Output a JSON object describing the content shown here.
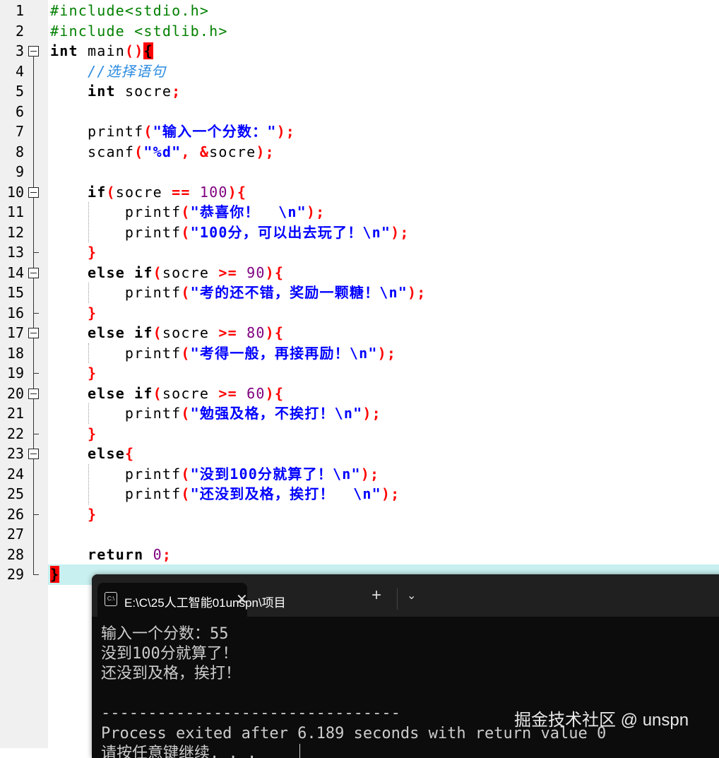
{
  "editor": {
    "current_line": 29,
    "fold_starts": [
      3,
      10,
      14,
      17,
      20,
      23
    ],
    "fold_ends": [
      13,
      16,
      19,
      22,
      26,
      29
    ],
    "lines": [
      [
        [
          "pp",
          "#include<stdio.h>"
        ]
      ],
      [
        [
          "pp",
          "#include <stdlib.h>"
        ]
      ],
      [
        [
          "kw",
          "int"
        ],
        [
          "id",
          " main"
        ],
        [
          "op",
          "()"
        ],
        [
          "hl",
          "{"
        ]
      ],
      [
        [
          "id",
          "    "
        ],
        [
          "cm",
          "//选择语句"
        ]
      ],
      [
        [
          "id",
          "    "
        ],
        [
          "kw",
          "int"
        ],
        [
          "id",
          " socre"
        ],
        [
          "op",
          ";"
        ]
      ],
      [],
      [
        [
          "id",
          "    printf"
        ],
        [
          "op",
          "("
        ],
        [
          "str",
          "\"输入一个分数：\""
        ],
        [
          "op",
          ");"
        ]
      ],
      [
        [
          "id",
          "    scanf"
        ],
        [
          "op",
          "("
        ],
        [
          "str",
          "\"%d\""
        ],
        [
          "op",
          ", &"
        ],
        [
          "id",
          "socre"
        ],
        [
          "op",
          ");"
        ]
      ],
      [],
      [
        [
          "id",
          "    "
        ],
        [
          "kw",
          "if"
        ],
        [
          "op",
          "("
        ],
        [
          "id",
          "socre "
        ],
        [
          "op",
          "=="
        ],
        [
          "id",
          " "
        ],
        [
          "num",
          "100"
        ],
        [
          "op",
          "){"
        ]
      ],
      [
        [
          "id",
          "        printf"
        ],
        [
          "op",
          "("
        ],
        [
          "str",
          "\"恭喜你！  \\n\""
        ],
        [
          "op",
          ");"
        ]
      ],
      [
        [
          "id",
          "        printf"
        ],
        [
          "op",
          "("
        ],
        [
          "str",
          "\"100分，可以出去玩了！\\n\""
        ],
        [
          "op",
          ");"
        ]
      ],
      [
        [
          "id",
          "    "
        ],
        [
          "op",
          "}"
        ]
      ],
      [
        [
          "id",
          "    "
        ],
        [
          "kw",
          "else if"
        ],
        [
          "op",
          "("
        ],
        [
          "id",
          "socre "
        ],
        [
          "op",
          ">="
        ],
        [
          "id",
          " "
        ],
        [
          "num",
          "90"
        ],
        [
          "op",
          "){"
        ]
      ],
      [
        [
          "id",
          "        printf"
        ],
        [
          "op",
          "("
        ],
        [
          "str",
          "\"考的还不错，奖励一颗糖！\\n\""
        ],
        [
          "op",
          ");"
        ]
      ],
      [
        [
          "id",
          "    "
        ],
        [
          "op",
          "}"
        ]
      ],
      [
        [
          "id",
          "    "
        ],
        [
          "kw",
          "else if"
        ],
        [
          "op",
          "("
        ],
        [
          "id",
          "socre "
        ],
        [
          "op",
          ">="
        ],
        [
          "id",
          " "
        ],
        [
          "num",
          "80"
        ],
        [
          "op",
          "){"
        ]
      ],
      [
        [
          "id",
          "        printf"
        ],
        [
          "op",
          "("
        ],
        [
          "str",
          "\"考得一般，再接再励！\\n\""
        ],
        [
          "op",
          ");"
        ]
      ],
      [
        [
          "id",
          "    "
        ],
        [
          "op",
          "}"
        ]
      ],
      [
        [
          "id",
          "    "
        ],
        [
          "kw",
          "else if"
        ],
        [
          "op",
          "("
        ],
        [
          "id",
          "socre "
        ],
        [
          "op",
          ">="
        ],
        [
          "id",
          " "
        ],
        [
          "num",
          "60"
        ],
        [
          "op",
          "){"
        ]
      ],
      [
        [
          "id",
          "        printf"
        ],
        [
          "op",
          "("
        ],
        [
          "str",
          "\"勉强及格，不挨打！\\n\""
        ],
        [
          "op",
          ");"
        ]
      ],
      [
        [
          "id",
          "    "
        ],
        [
          "op",
          "}"
        ]
      ],
      [
        [
          "id",
          "    "
        ],
        [
          "kw",
          "else"
        ],
        [
          "op",
          "{"
        ]
      ],
      [
        [
          "id",
          "        printf"
        ],
        [
          "op",
          "("
        ],
        [
          "str",
          "\"没到100分就算了！\\n\""
        ],
        [
          "op",
          ");"
        ]
      ],
      [
        [
          "id",
          "        printf"
        ],
        [
          "op",
          "("
        ],
        [
          "str",
          "\"还没到及格，挨打！  \\n\""
        ],
        [
          "op",
          ");"
        ]
      ],
      [
        [
          "id",
          "    "
        ],
        [
          "op",
          "}"
        ]
      ],
      [],
      [
        [
          "id",
          "    "
        ],
        [
          "kw",
          "return"
        ],
        [
          "id",
          " "
        ],
        [
          "num",
          "0"
        ],
        [
          "op",
          ";"
        ]
      ],
      [
        [
          "hl",
          "}"
        ]
      ]
    ]
  },
  "terminal": {
    "tab_icon": "C:\\",
    "tab_title": "E:\\C\\25人工智能01unspn\\项目",
    "close_icon": "✕",
    "new_tab_icon": "+",
    "dropdown_icon": "⌄",
    "output": [
      "输入一个分数：55",
      "没到100分就算了！",
      "还没到及格，挨打！",
      "",
      "--------------------------------",
      "Process exited after 6.189 seconds with return value 0",
      "请按任意键继续. . ."
    ],
    "watermark": "掘金技术社区 @ unspn"
  }
}
